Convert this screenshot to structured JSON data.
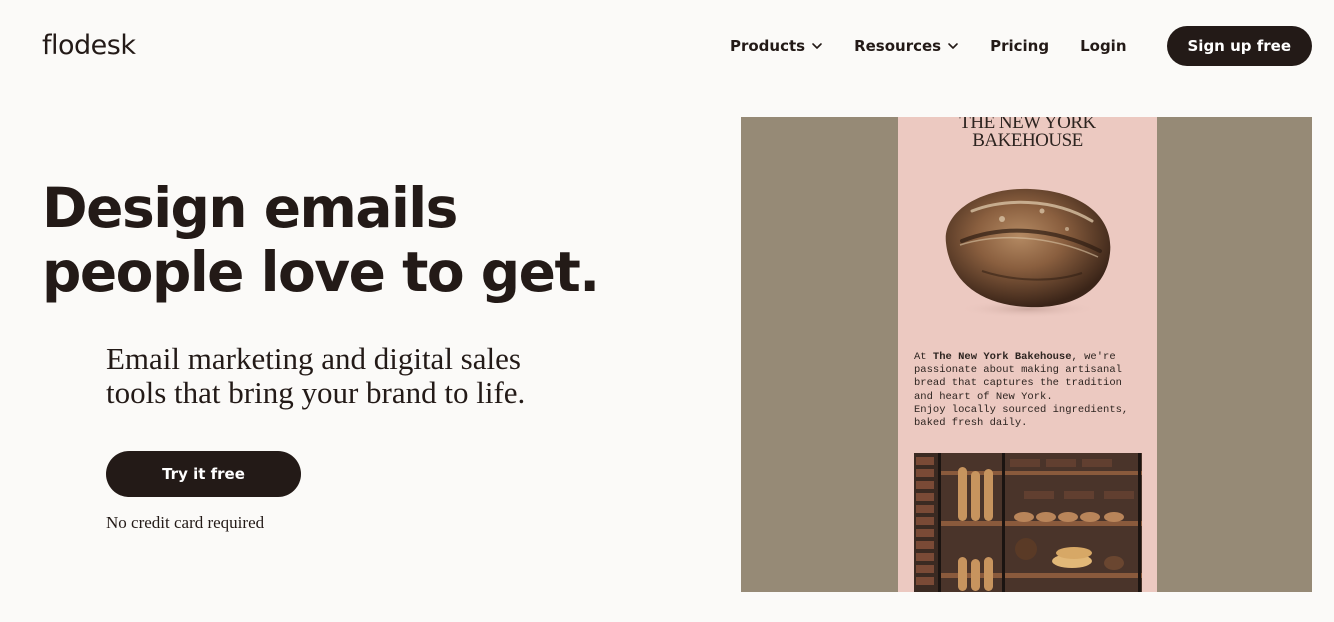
{
  "header": {
    "logo": "flodesk",
    "nav": {
      "products": "Products",
      "resources": "Resources",
      "pricing": "Pricing",
      "login": "Login"
    },
    "signup_label": "Sign up free"
  },
  "hero": {
    "headline_line1": "Design emails",
    "headline_line2": "people love to get.",
    "subhead_line1": "Email marketing and digital sales",
    "subhead_line2": "tools that bring your brand to life.",
    "cta_label": "Try it free",
    "note": "No credit card required"
  },
  "email_preview": {
    "title_line1": "THE NEW YORK",
    "title_line2": "BAKEHOUSE",
    "body_prefix": "At ",
    "body_brand": "The New York Bakehouse",
    "body_rest": ", we're\npassionate about making artisanal\nbread that captures the tradition\nand heart of New York.\nEnjoy locally sourced ingredients,\nbaked fresh daily."
  },
  "colors": {
    "text_dark": "#231a17",
    "page_bg": "#fbfaf8",
    "preview_bg": "#968a76",
    "email_bg": "#ecc9c1"
  }
}
